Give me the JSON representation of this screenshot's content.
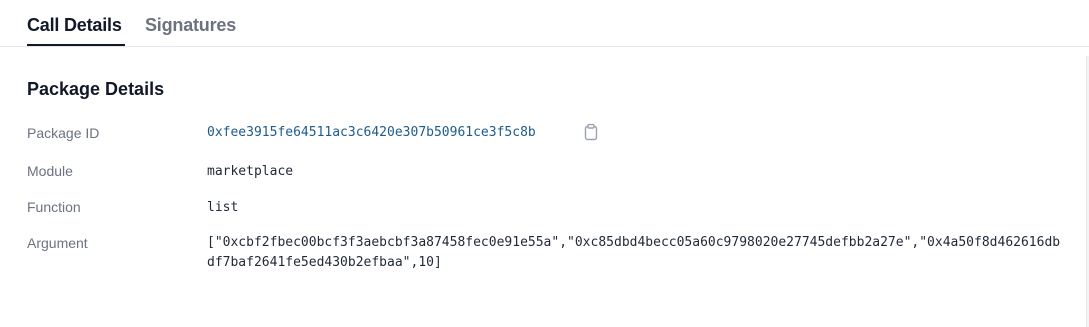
{
  "tabs": [
    {
      "label": "Call Details",
      "active": true
    },
    {
      "label": "Signatures",
      "active": false
    }
  ],
  "section": {
    "title": "Package Details"
  },
  "details": {
    "package_id_label": "Package ID",
    "package_id_value": "0xfee3915fe64511ac3c6420e307b50961ce3f5c8b",
    "module_label": "Module",
    "module_value": "marketplace",
    "function_label": "Function",
    "function_value": "list",
    "argument_label": "Argument",
    "argument_value": "[\"0xcbf2fbec00bcf3f3aebcbf3a87458fec0e91e55a\",\"0xc85dbd4becc05a60c9798020e27745defbb2a27e\",\"0x4a50f8d462616dbdf7baf2641fe5ed430b2efbaa\",10]"
  },
  "icons": {
    "copy": "clipboard-icon"
  },
  "colors": {
    "link": "#1e5b8c",
    "active_tab": "#111827",
    "inactive_tab": "#6b7280",
    "label": "#6b7280"
  }
}
